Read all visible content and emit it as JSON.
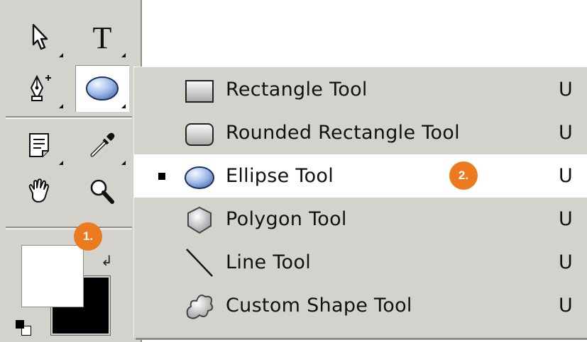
{
  "toolbox": {
    "tools": [
      {
        "name": "selection-arrow-icon"
      },
      {
        "name": "type-tool-icon",
        "glyph": "T"
      },
      {
        "name": "pen-tool-icon"
      },
      {
        "name": "ellipse-tool-icon"
      },
      {
        "name": "notes-tool-icon"
      },
      {
        "name": "eyedropper-tool-icon"
      },
      {
        "name": "hand-tool-icon"
      },
      {
        "name": "zoom-tool-icon"
      }
    ],
    "step1_badge": "1.",
    "foreground_color": "#ffffff",
    "background_color": "#000000"
  },
  "menu": {
    "items": [
      {
        "label": "Rectangle Tool",
        "shortcut": "U",
        "icon": "rectangle-icon",
        "checked": false
      },
      {
        "label": "Rounded Rectangle Tool",
        "shortcut": "U",
        "icon": "rounded-rectangle-icon",
        "checked": false
      },
      {
        "label": "Ellipse Tool",
        "shortcut": "U",
        "icon": "ellipse-icon",
        "checked": true
      },
      {
        "label": "Polygon Tool",
        "shortcut": "U",
        "icon": "polygon-icon",
        "checked": false
      },
      {
        "label": "Line Tool",
        "shortcut": "U",
        "icon": "line-icon",
        "checked": false
      },
      {
        "label": "Custom Shape Tool",
        "shortcut": "U",
        "icon": "custom-shape-icon",
        "checked": false
      }
    ],
    "step2_badge": "2."
  },
  "colors": {
    "panel": "#d4d2cc",
    "badge": "#ec7a1f",
    "highlight": "#ffffff"
  }
}
